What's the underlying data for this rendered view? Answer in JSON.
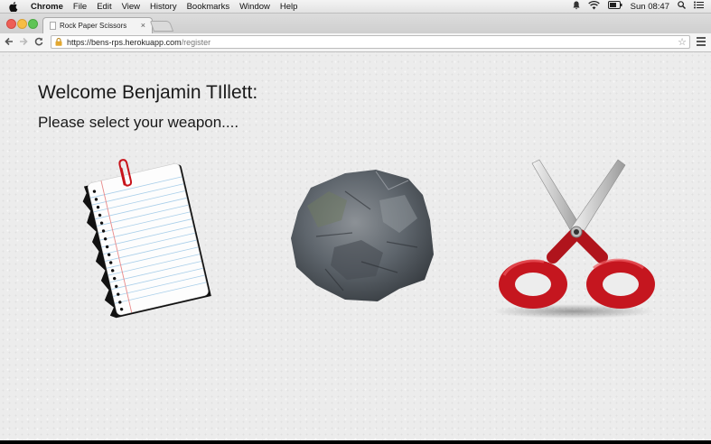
{
  "menubar": {
    "apple_icon": "apple-icon",
    "items": [
      "Chrome",
      "File",
      "Edit",
      "View",
      "History",
      "Bookmarks",
      "Window",
      "Help"
    ],
    "clock": "Sun 08:47",
    "status_icons": [
      "notification-icon",
      "wifi-icon",
      "battery-icon",
      "spotlight-icon",
      "notification-center-icon"
    ]
  },
  "browser": {
    "tab_title": "Rock Paper Scissors",
    "tab_close": "×",
    "url_host": "https://bens-rps.herokuapp.com",
    "url_path": "/register",
    "colors": {
      "close": "#ee5f57",
      "minimize": "#f7bd45",
      "zoom": "#5fc456"
    }
  },
  "page": {
    "welcome": "Welcome Benjamin TIllett:",
    "prompt": "Please select your weapon....",
    "weapons": [
      "paper",
      "rock",
      "scissors"
    ]
  }
}
